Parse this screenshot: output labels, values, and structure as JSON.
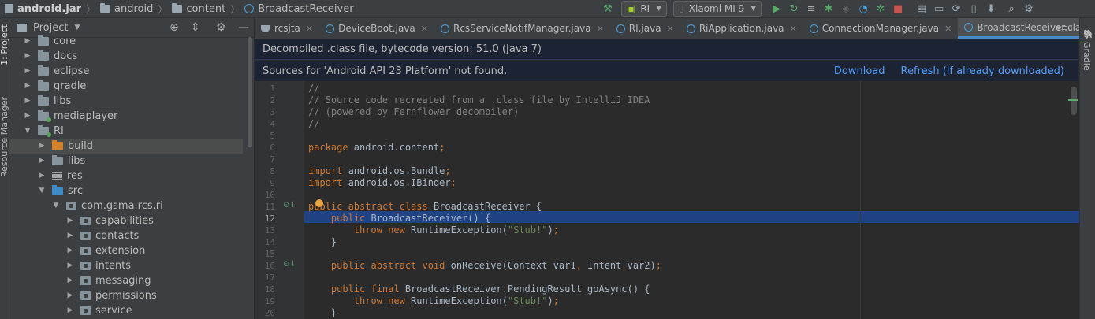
{
  "breadcrumb": [
    "android.jar",
    "android",
    "content",
    "BroadcastReceiver"
  ],
  "run_config": "RI",
  "device": "Xiaomi MI 9",
  "left_strip": {
    "label_project": "1: Project",
    "label_resource": "Resource Manager"
  },
  "right_strip": {
    "label": "Gradle"
  },
  "project_panel": {
    "title": "Project"
  },
  "tree": [
    {
      "label": "core",
      "indent": 0,
      "type": "folder",
      "expanded": false
    },
    {
      "label": "docs",
      "indent": 0,
      "type": "folder",
      "expanded": false
    },
    {
      "label": "eclipse",
      "indent": 0,
      "type": "folder",
      "expanded": false
    },
    {
      "label": "gradle",
      "indent": 0,
      "type": "folder",
      "expanded": false
    },
    {
      "label": "libs",
      "indent": 0,
      "type": "folder",
      "expanded": false
    },
    {
      "label": "mediaplayer",
      "indent": 0,
      "type": "module",
      "expanded": false
    },
    {
      "label": "RI",
      "indent": 0,
      "type": "module",
      "expanded": true
    },
    {
      "label": "build",
      "indent": 1,
      "type": "folder-orange",
      "expanded": false,
      "selected": true
    },
    {
      "label": "libs",
      "indent": 1,
      "type": "folder",
      "expanded": false
    },
    {
      "label": "res",
      "indent": 1,
      "type": "res",
      "expanded": false
    },
    {
      "label": "src",
      "indent": 1,
      "type": "folder-blue",
      "expanded": true
    },
    {
      "label": "com.gsma.rcs.ri",
      "indent": 2,
      "type": "package",
      "expanded": true
    },
    {
      "label": "capabilities",
      "indent": 3,
      "type": "package",
      "expanded": false
    },
    {
      "label": "contacts",
      "indent": 3,
      "type": "package",
      "expanded": false
    },
    {
      "label": "extension",
      "indent": 3,
      "type": "package",
      "expanded": false
    },
    {
      "label": "intents",
      "indent": 3,
      "type": "package",
      "expanded": false
    },
    {
      "label": "messaging",
      "indent": 3,
      "type": "package",
      "expanded": false
    },
    {
      "label": "permissions",
      "indent": 3,
      "type": "package",
      "expanded": false
    },
    {
      "label": "service",
      "indent": 3,
      "type": "package",
      "expanded": false
    }
  ],
  "tabs": [
    {
      "label": "rcsjta",
      "icon": "gradle",
      "active": false
    },
    {
      "label": "DeviceBoot.java",
      "icon": "class",
      "active": false
    },
    {
      "label": "RcsServiceNotifManager.java",
      "icon": "class",
      "active": false
    },
    {
      "label": "RI.java",
      "icon": "class",
      "active": false
    },
    {
      "label": "RiApplication.java",
      "icon": "class",
      "active": false
    },
    {
      "label": "ConnectionManager.java",
      "icon": "class",
      "active": false
    },
    {
      "label": "BroadcastReceiver.class",
      "icon": "class",
      "active": true
    }
  ],
  "tab_overflow": "3",
  "banner_decompiled": "Decompiled .class file, bytecode version: 51.0 (Java 7)",
  "banner_sources": {
    "text": "Sources for 'Android API 23 Platform' not found.",
    "download": "Download",
    "refresh": "Refresh (if already downloaded)"
  },
  "current_line": 12,
  "code_lines": [
    [
      {
        "t": "//",
        "c": "cm"
      }
    ],
    [
      {
        "t": "// Source code recreated from a .class file by IntelliJ IDEA",
        "c": "cm"
      }
    ],
    [
      {
        "t": "// (powered by Fernflower decompiler)",
        "c": "cm"
      }
    ],
    [
      {
        "t": "//",
        "c": "cm"
      }
    ],
    [],
    [
      {
        "t": "package ",
        "c": "kw"
      },
      {
        "t": "android.content",
        "c": ""
      },
      {
        "t": ";",
        "c": "kw"
      }
    ],
    [],
    [
      {
        "t": "import ",
        "c": "kw"
      },
      {
        "t": "android.os.Bundle",
        "c": ""
      },
      {
        "t": ";",
        "c": "kw"
      }
    ],
    [
      {
        "t": "import ",
        "c": "kw"
      },
      {
        "t": "android.os.IBinder",
        "c": ""
      },
      {
        "t": ";",
        "c": "kw"
      }
    ],
    [],
    [
      {
        "t": "public abstract class ",
        "c": "kw"
      },
      {
        "t": "BroadcastReceiver {",
        "c": ""
      }
    ],
    [
      {
        "t": "    public ",
        "c": "kw"
      },
      {
        "t": "BroadcastReceiver() {",
        "c": ""
      }
    ],
    [
      {
        "t": "        throw new ",
        "c": "kw"
      },
      {
        "t": "RuntimeException(",
        "c": ""
      },
      {
        "t": "\"Stub!\"",
        "c": "str"
      },
      {
        "t": ")",
        "c": ""
      },
      {
        "t": ";",
        "c": "kw"
      }
    ],
    [
      {
        "t": "    }",
        "c": ""
      }
    ],
    [],
    [
      {
        "t": "    public abstract void ",
        "c": "kw"
      },
      {
        "t": "onReceive(Context var1",
        "c": ""
      },
      {
        "t": ", ",
        "c": "kw"
      },
      {
        "t": "Intent var2)",
        "c": ""
      },
      {
        "t": ";",
        "c": "kw"
      }
    ],
    [],
    [
      {
        "t": "    public final ",
        "c": "kw"
      },
      {
        "t": "BroadcastReceiver.PendingResult goAsync() {",
        "c": ""
      }
    ],
    [
      {
        "t": "        throw new ",
        "c": "kw"
      },
      {
        "t": "RuntimeException(",
        "c": ""
      },
      {
        "t": "\"Stub!\"",
        "c": "str"
      },
      {
        "t": ")",
        "c": ""
      },
      {
        "t": ";",
        "c": "kw"
      }
    ],
    [
      {
        "t": "    }",
        "c": ""
      }
    ]
  ],
  "gutter_marks": [
    {
      "line": 11,
      "icon": "overridden-icon"
    },
    {
      "line": 16,
      "icon": "implemented-icon"
    }
  ]
}
